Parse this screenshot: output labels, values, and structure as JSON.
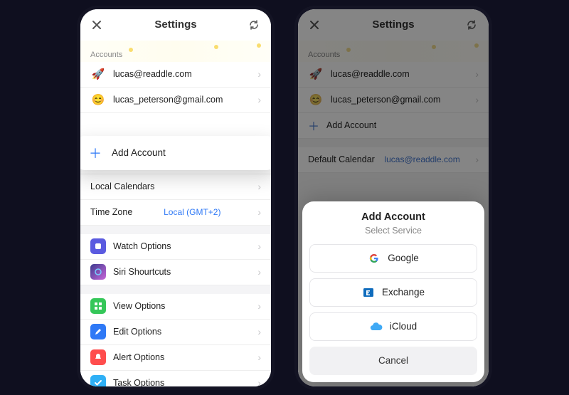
{
  "header": {
    "title": "Settings"
  },
  "accounts": {
    "label": "Accounts",
    "items": [
      {
        "icon": "🚀",
        "email": "lucas@readdle.com"
      },
      {
        "icon": "😊",
        "email": "lucas_peterson@gmail.com"
      }
    ],
    "add_label": "Add Account"
  },
  "calendar": {
    "default_label": "Default Calendar",
    "default_value": "lucas@readdle.com",
    "local_label": "Local Calendars",
    "tz_label": "Time Zone",
    "tz_value": "Local (GMT+2)"
  },
  "group1": {
    "watch": "Watch Options",
    "siri": "Siri Shourtcuts"
  },
  "group2": {
    "view": "View Options",
    "edit": "Edit Options",
    "alert": "Alert Options",
    "task": "Task Options"
  },
  "sheet": {
    "title": "Add Account",
    "subtitle": "Select Service",
    "services": [
      {
        "name": "Google"
      },
      {
        "name": "Exchange"
      },
      {
        "name": "iCloud"
      }
    ],
    "cancel": "Cancel"
  }
}
